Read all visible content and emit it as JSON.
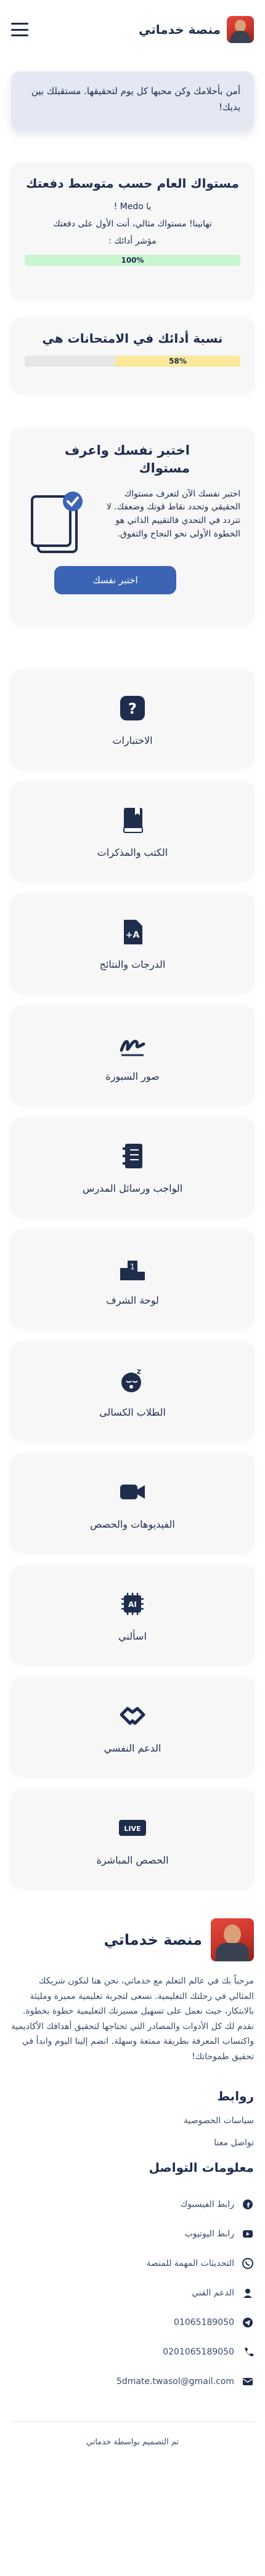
{
  "header": {
    "brand": "منصة خدماتي",
    "menu_icon": "menu-icon"
  },
  "hero": {
    "note": "أمن بأحلامك وكن محبها كل يوم لتحقيقها. مستقبلك بين يديك!"
  },
  "level": {
    "title": "مستواك العام حسب متوسط دفعتك",
    "greeting": "يا Medo !",
    "congrats": "تهانينا! مستواك مثالي، أنت الأول على دفعتك",
    "indicator": "مؤشر أدائك :",
    "percent": 1.0,
    "percent_label": "100%",
    "fill_color": "#c9f5cf"
  },
  "rank": {
    "title": "نسبة أدائك في الامتحانات هي",
    "percent": 0.58,
    "percent_label": "58%",
    "fill_color": "#fbe89a"
  },
  "quiz": {
    "title": "اختبر نفسك واعرف مستواك",
    "text": "اختبر نفسك الآن لتعرف مستواك الحقيقي وتحدد نقاط قوتك وضعفك. لا تتردد في التحدي فالتقييم الذاتي هو الخطوة الأولى نحو النجاح والتفوق.",
    "button": "اختبر نفسك"
  },
  "tiles": [
    {
      "label": "الاختبارات",
      "icon": "question-icon"
    },
    {
      "label": "الكتب والمذكرات",
      "icon": "book-icon"
    },
    {
      "label": "الدرجات والنتائج",
      "icon": "grade-icon"
    },
    {
      "label": "صور السبورة",
      "icon": "signature-icon"
    },
    {
      "label": "الواجب ورسائل المدرس",
      "icon": "notebook-icon"
    },
    {
      "label": "لوحة الشرف",
      "icon": "podium-icon"
    },
    {
      "label": "الطلاب الكسالى",
      "icon": "sleepy-face-icon"
    },
    {
      "label": "الفيديوهات والحصص",
      "icon": "video-icon"
    },
    {
      "label": "اسألني",
      "icon": "ai-chip-icon"
    },
    {
      "label": "الدعم النفسي",
      "icon": "handshake-icon"
    },
    {
      "label": "الحصص المباشرة",
      "icon": "live-icon",
      "badge": "LIVE"
    }
  ],
  "footer": {
    "brand": "منصة خدماتي",
    "description": "مرحباً بك في عالم التعلم مع خدماتي، نحن هنا لنكون شريكك المثالي في رحلتك التعليمية. نسعى لتجربة تعليمية مميزة ومليئة بالابتكار، حيث نعمل على تسهيل مسيرتك التعليمية خطوة بخطوة. نقدم لك كل الأدوات والمصادر التي تحتاجها لتحقيق أهدافك الأكاديمية واكتساب المعرفة بطريقة ممتعة وسهلة. انضم إلينا اليوم وابدأ في تحقيق طموحاتك!",
    "links_heading": "روابط",
    "links": [
      "سياسات الخصوصية",
      "تواصل معنا"
    ],
    "contact_heading": "معلومات التواصل",
    "contacts": [
      {
        "label": "رابط الفيسبوك",
        "icon": "facebook-icon"
      },
      {
        "label": "رابط اليوتيوب",
        "icon": "youtube-icon"
      },
      {
        "label": "التحديثات المهمة للمنصة",
        "icon": "whatsapp-icon"
      },
      {
        "label": "الدعم الفني",
        "icon": "support-icon"
      },
      {
        "label": "01065189050",
        "icon": "telegram-icon"
      },
      {
        "label": "0201065189050",
        "icon": "phone-icon"
      },
      {
        "label": "5dmate.twasol@gmail.com",
        "icon": "mail-icon"
      }
    ],
    "copyright": "تم التصميم بواسطة خدماتي"
  },
  "colors": {
    "primary": "#1f2d4d",
    "accent": "#3b64b5",
    "card": "#f7f7f8"
  }
}
